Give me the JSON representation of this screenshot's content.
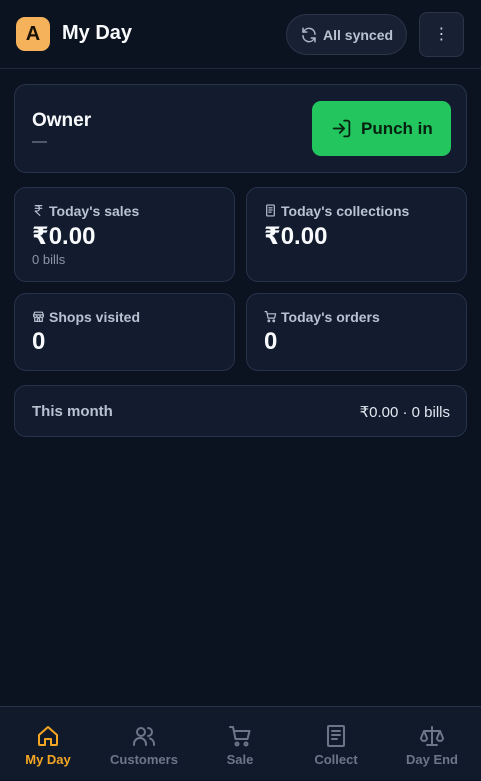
{
  "header": {
    "avatar_letter": "A",
    "title": "My Day",
    "sync_label": "All synced",
    "menu_icon": "⋮"
  },
  "owner": {
    "name": "Owner",
    "subtitle": "—",
    "punch_label": "Punch in"
  },
  "stats": {
    "sales": {
      "label": "Today's sales",
      "value": "₹0.00",
      "sub": "0 bills"
    },
    "collections": {
      "label": "Today's collections",
      "value": "₹0.00"
    },
    "shops": {
      "label": "Shops visited",
      "value": "0"
    },
    "orders": {
      "label": "Today's orders",
      "value": "0"
    }
  },
  "month": {
    "label": "This month",
    "value": "₹0.00 · 0 bills"
  },
  "nav": [
    {
      "label": "My Day",
      "icon": "home-icon",
      "active": true
    },
    {
      "label": "Customers",
      "icon": "users-icon",
      "active": false
    },
    {
      "label": "Sale",
      "icon": "cart-icon",
      "active": false
    },
    {
      "label": "Collect",
      "icon": "receipt-icon",
      "active": false
    },
    {
      "label": "Day End",
      "icon": "scale-icon",
      "active": false
    }
  ],
  "colors": {
    "accent": "#f5a623",
    "success": "#22c55e",
    "background": "#0b1220",
    "card": "#131c2e"
  }
}
